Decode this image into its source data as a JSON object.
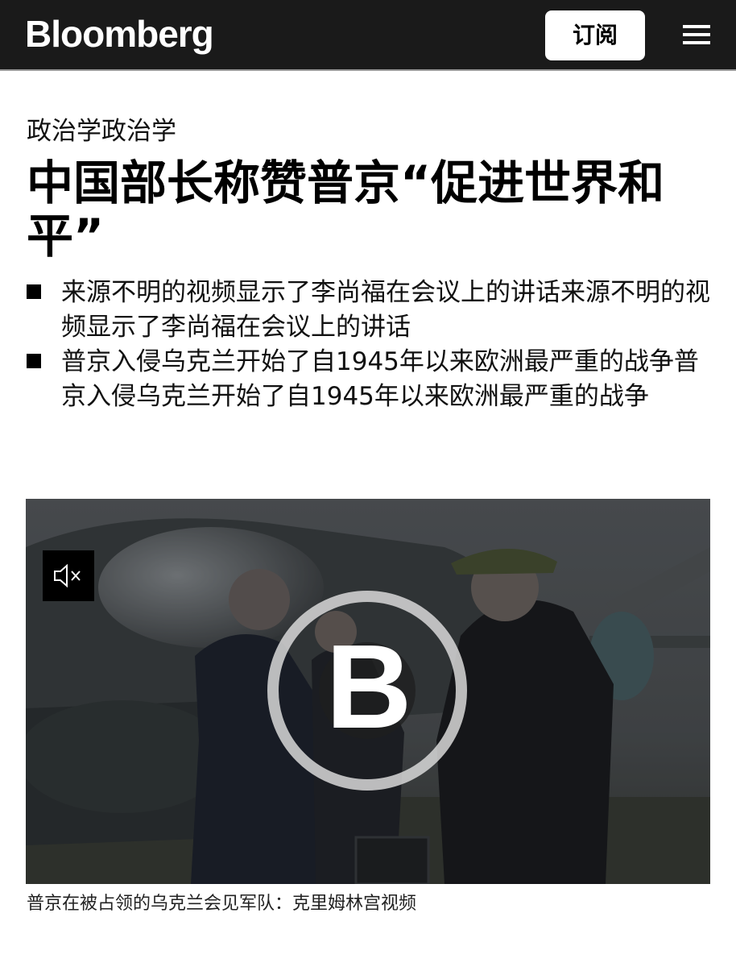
{
  "header": {
    "logo": "Bloomberg",
    "subscribe_label": "订阅",
    "menu_icon": "hamburger-menu-icon"
  },
  "article": {
    "kicker": "政治学政治学",
    "headline": "中国部长称赞普京“促进世界和平”",
    "bullets": [
      "来源不明的视频显示了李尚福在会议上的讲话来源不明的视频显示了李尚福在会议上的讲话",
      "普京入侵乌克兰开始了自1945年以来欧洲最严重的战争普京入侵乌克兰开始了自1945年以来欧洲最严重的战争"
    ]
  },
  "video": {
    "mute_icon": "speaker-muted-icon",
    "play_icon": "bloomberg-b-play-icon",
    "caption": "普京在被占领的乌克兰会见军队：克里姆林宫视频"
  },
  "colors": {
    "header_bg": "#1a1a1a",
    "text": "#000000",
    "button_bg": "#ffffff"
  }
}
